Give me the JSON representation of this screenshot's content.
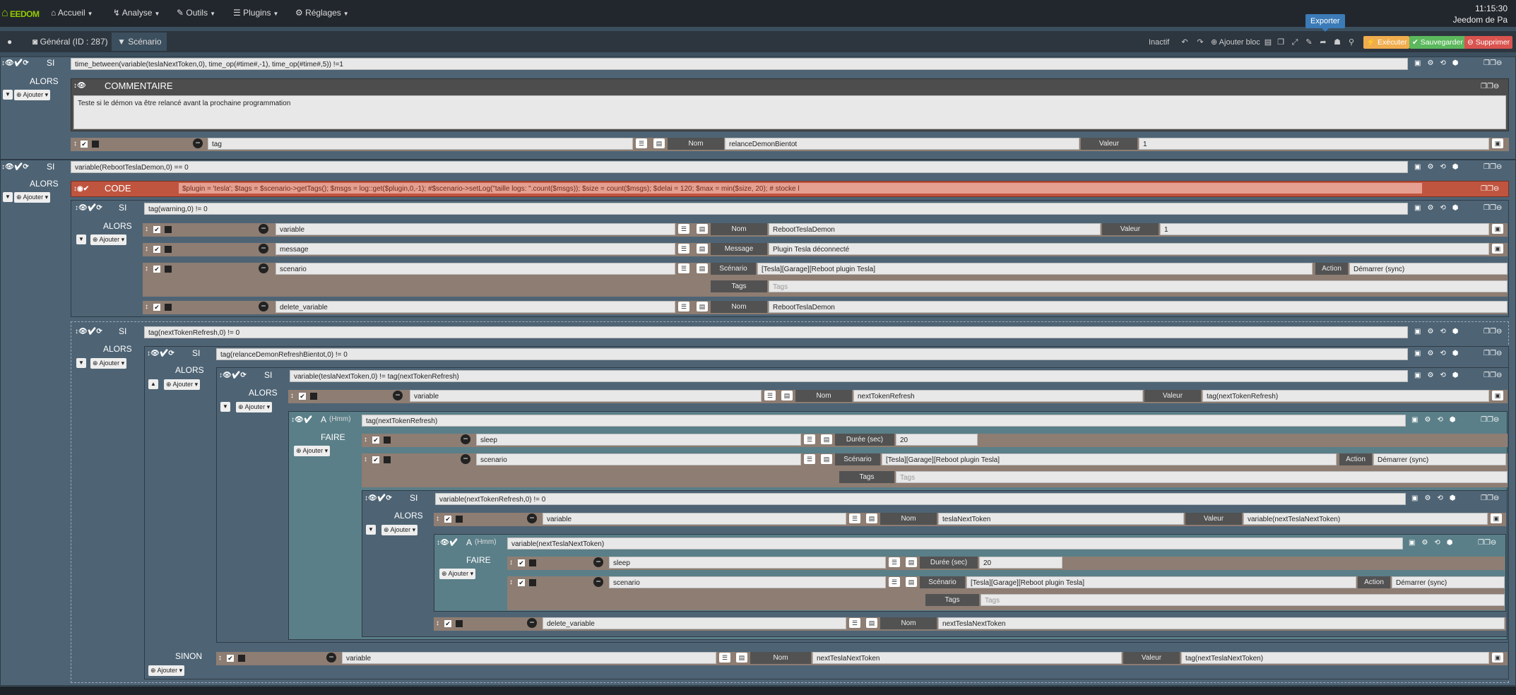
{
  "nav": {
    "brand": "EEDOM",
    "menus": [
      "Accueil",
      "Analyse",
      "Outils",
      "Plugins",
      "Réglages"
    ],
    "time": "11:15:30",
    "user": "Jeedom de Pa"
  },
  "toolbar": {
    "general_tab": "Général (ID : 287)",
    "scenario_tab": "Scénario",
    "status": "Inactif",
    "add_bloc": "Ajouter bloc",
    "execute": "Exécuter",
    "save": "Sauvegarder",
    "delete": "Supprimer",
    "tooltip": "Exporter",
    "accent_colors": {
      "execute": "#f0ad4e",
      "save": "#5cb85c",
      "delete": "#d9534f"
    }
  },
  "blocks": {
    "si": "SI",
    "alors": "ALORS",
    "sinon": "SINON",
    "faire": "FAIRE",
    "commentaire": "COMMENTAIRE",
    "code": "CODE",
    "a_label": "A",
    "hmm": "(Hmm)",
    "ajouter": "Ajouter",
    "b1_cond": "time_between(variable(teslaNextToken,0), time_op(#time#,-1), time_op(#time#,5)) !=1",
    "comment_text": "Teste si le démon va être relancé avant la prochaine programmation",
    "b1_action": {
      "cmd": "tag",
      "nom_label": "Nom",
      "nom": "relanceDemonBientot",
      "val_label": "Valeur",
      "val": "1"
    },
    "b2_cond": "variable(RebootTeslaDemon,0) == 0",
    "code_text": "$plugin = 'tesla'; $tags = $scenario->getTags(); $msgs = log::get($plugin,0,-1); #$scenario->setLog(\"taille logs: \".count($msgs)); $size = count($msgs); $delai = 120; $max = min($size, 20); # stocke l",
    "b3_cond": "tag(warning,0) != 0",
    "b3_a1": {
      "cmd": "variable",
      "nom_label": "Nom",
      "nom": "RebootTeslaDemon",
      "val_label": "Valeur",
      "val": "1"
    },
    "b3_a2": {
      "cmd": "message",
      "msg_label": "Message",
      "msg": "Plugin Tesla déconnecté"
    },
    "b3_a3": {
      "cmd": "scenario",
      "sc_label": "Scénario",
      "sc": "[Tesla][Garage][Reboot plugin Tesla]",
      "action_label": "Action",
      "action": "Démarrer (sync)",
      "tags_label": "Tags",
      "tags_ph": "Tags"
    },
    "b3_a4": {
      "cmd": "delete_variable",
      "nom_label": "Nom",
      "nom": "RebootTeslaDemon"
    },
    "b4_cond": "tag(nextTokenRefresh,0) != 0",
    "b5_cond": "tag(relanceDemonRefreshBientot,0) != 0",
    "b6_cond": "variable(teslaNextToken,0) != tag(nextTokenRefresh)",
    "b6_a1": {
      "cmd": "variable",
      "nom_label": "Nom",
      "nom": "nextTokenRefresh",
      "val_label": "Valeur",
      "val": "tag(nextTokenRefresh)"
    },
    "a1_cond": "tag(nextTokenRefresh)",
    "a1_s1": {
      "cmd": "sleep",
      "dur_label": "Durée (sec)",
      "dur": "20"
    },
    "a1_s2": {
      "cmd": "scenario",
      "sc_label": "Scénario",
      "sc": "[Tesla][Garage][Reboot plugin Tesla]",
      "action_label": "Action",
      "action": "Démarrer (sync)",
      "tags_label": "Tags",
      "tags_ph": "Tags"
    },
    "b7_cond": "variable(nextTokenRefresh,0) != 0",
    "b7_a1": {
      "cmd": "variable",
      "nom_label": "Nom",
      "nom": "teslaNextToken",
      "val_label": "Valeur",
      "val": "variable(nextTeslaNextToken)"
    },
    "a2_cond": "variable(nextTeslaNextToken)",
    "a2_s1": {
      "cmd": "sleep",
      "dur_label": "Durée (sec)",
      "dur": "20"
    },
    "a2_s2": {
      "cmd": "scenario",
      "sc_label": "Scénario",
      "sc": "[Tesla][Garage][Reboot plugin Tesla]",
      "action_label": "Action",
      "action": "Démarrer (sync)",
      "tags_label": "Tags",
      "tags_ph": "Tags"
    },
    "b7_a3": {
      "cmd": "delete_variable",
      "nom_label": "Nom",
      "nom": "nextTeslaNextToken"
    },
    "sinon_a1": {
      "cmd": "variable",
      "nom_label": "Nom",
      "nom": "nextTeslaNextToken",
      "val_label": "Valeur",
      "val": "tag(nextTeslaNextToken)"
    }
  }
}
